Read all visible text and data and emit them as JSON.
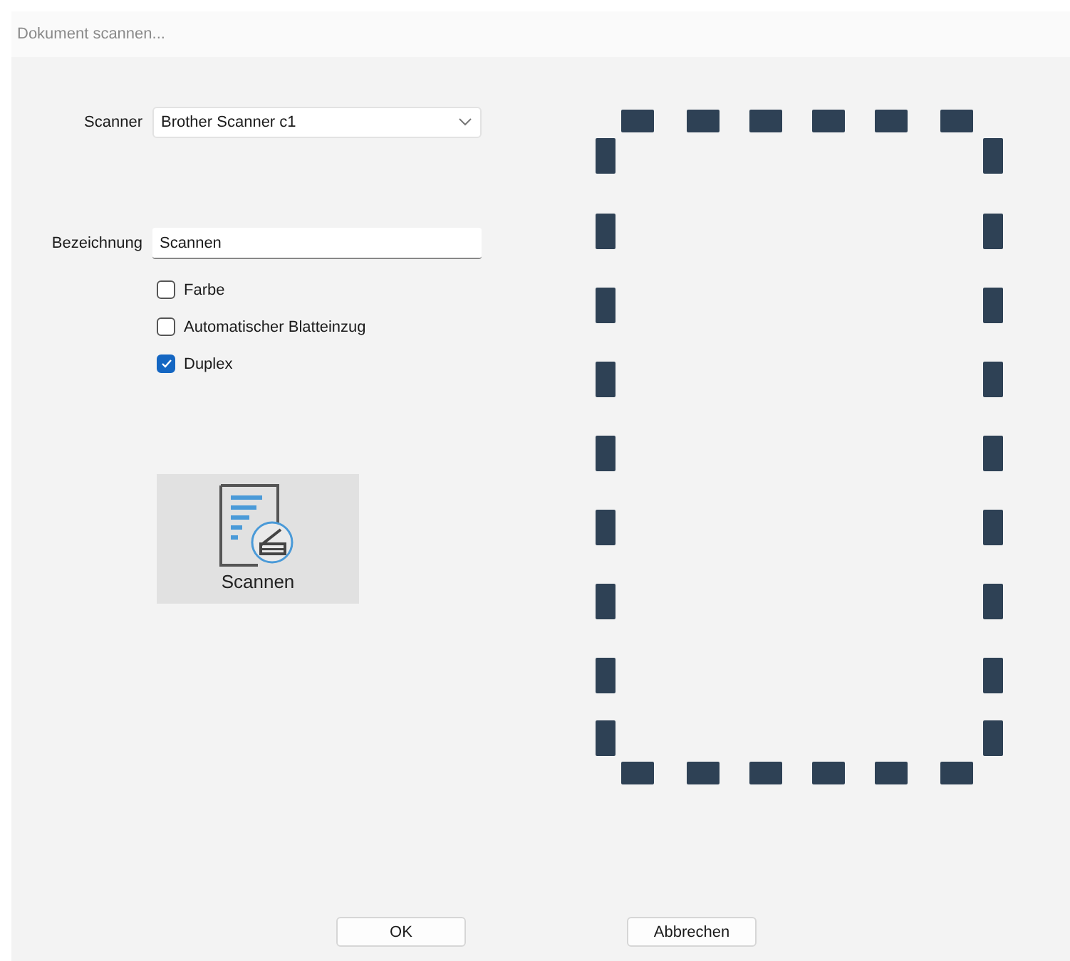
{
  "window": {
    "title": "Dokument scannen..."
  },
  "scanner": {
    "label": "Scanner",
    "value": "Brother Scanner c1"
  },
  "name_field": {
    "label": "Bezeichnung",
    "value": "Scannen"
  },
  "options": [
    {
      "label": "Farbe",
      "checked": false
    },
    {
      "label": "Automatischer Blatteinzug",
      "checked": false
    },
    {
      "label": "Duplex",
      "checked": true
    }
  ],
  "scan_button": {
    "label": "Scannen"
  },
  "buttons": [
    "OK",
    "Abbrechen"
  ]
}
